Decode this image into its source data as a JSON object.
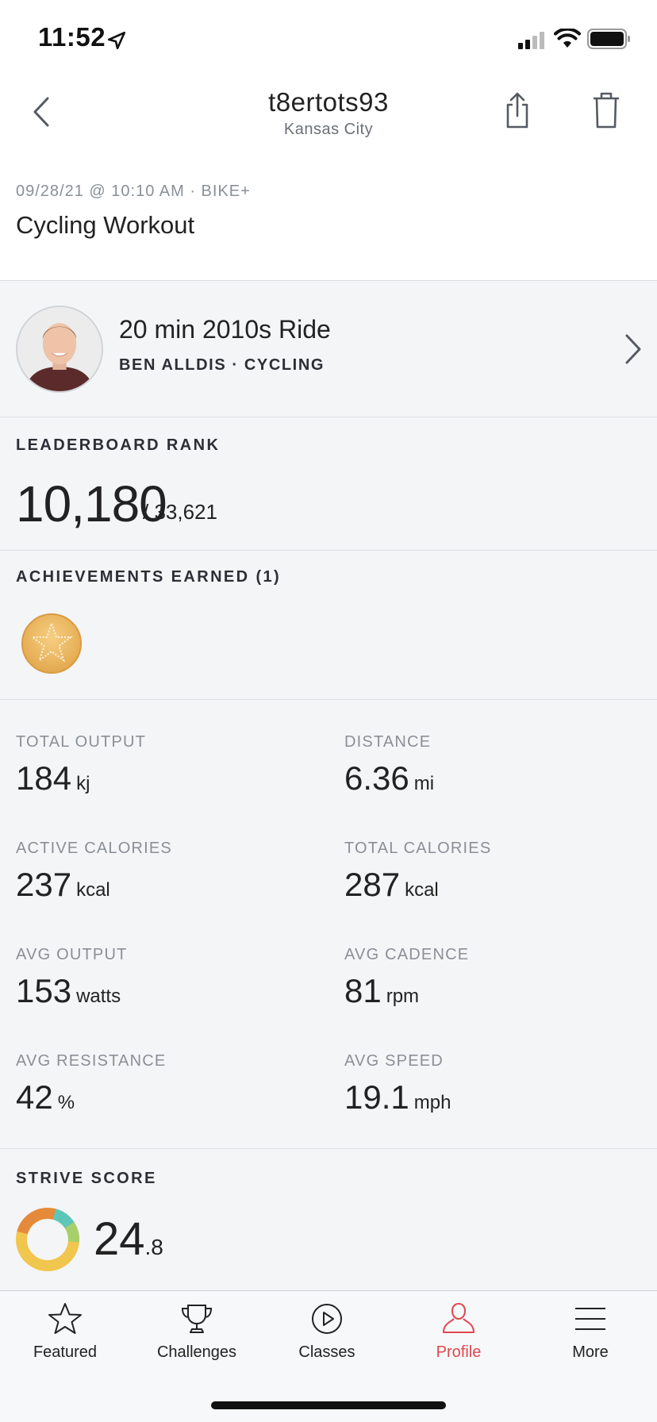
{
  "status_bar": {
    "time": "11:52"
  },
  "header": {
    "title": "t8ertots93",
    "subtitle": "Kansas City"
  },
  "workout": {
    "meta": "09/28/21 @ 10:10 AM  ·  BIKE+",
    "title": "Cycling Workout"
  },
  "class_info": {
    "title": "20 min 2010s Ride",
    "instructor_line": "BEN ALLDIS  ·  CYCLING"
  },
  "leaderboard": {
    "heading": "LEADERBOARD RANK",
    "rank": "10,180",
    "total": "/ 33,621"
  },
  "achievements": {
    "heading": "ACHIEVEMENTS EARNED (1)"
  },
  "stats": [
    {
      "label": "TOTAL OUTPUT",
      "value": "184",
      "unit": "kj"
    },
    {
      "label": "DISTANCE",
      "value": "6.36",
      "unit": "mi"
    },
    {
      "label": "ACTIVE CALORIES",
      "value": "237",
      "unit": "kcal"
    },
    {
      "label": "TOTAL CALORIES",
      "value": "287",
      "unit": "kcal"
    },
    {
      "label": "AVG OUTPUT",
      "value": "153",
      "unit": "watts"
    },
    {
      "label": "AVG CADENCE",
      "value": "81",
      "unit": "rpm"
    },
    {
      "label": "AVG RESISTANCE",
      "value": "42",
      "unit": "%"
    },
    {
      "label": "AVG SPEED",
      "value": "19.1",
      "unit": "mph"
    }
  ],
  "strive": {
    "heading": "STRIVE SCORE",
    "value_int": "24",
    "value_dec": ".8",
    "zone_colors": [
      "#e58a3b",
      "#5cc7b9",
      "#a7cf6a",
      "#f1c64e"
    ]
  },
  "tabs": [
    {
      "label": "Featured",
      "icon": "star-icon"
    },
    {
      "label": "Challenges",
      "icon": "trophy-icon"
    },
    {
      "label": "Classes",
      "icon": "play-circle-icon"
    },
    {
      "label": "Profile",
      "icon": "person-icon",
      "active": true
    },
    {
      "label": "More",
      "icon": "menu-icon"
    }
  ],
  "colors": {
    "accent_active": "#e0474d",
    "medal": "#e8b35c"
  }
}
